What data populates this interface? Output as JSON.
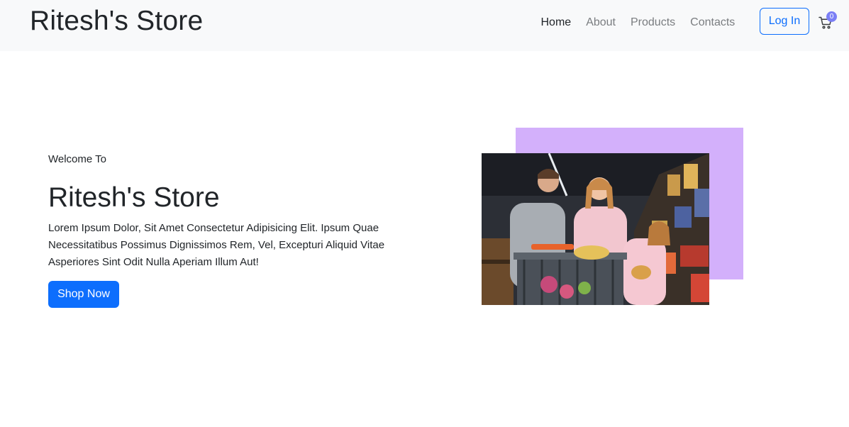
{
  "navbar": {
    "brand": "Ritesh's Store",
    "links": [
      {
        "label": "Home",
        "active": true
      },
      {
        "label": "About",
        "active": false
      },
      {
        "label": "Products",
        "active": false
      },
      {
        "label": "Contacts",
        "active": false
      }
    ],
    "login_label": "Log In",
    "cart_icon": "cart-icon",
    "cart_count": "0"
  },
  "hero": {
    "welcome": "Welcome To",
    "title": "Ritesh's Store",
    "description": "Lorem Ipsum Dolor, Sit Amet Consectetur Adipisicing Elit. Ipsum Quae Necessitatibus Possimus Dignissimos Rem, Vel, Excepturi Aliquid Vitae Asperiores Sint Odit Nulla Aperiam Illum Aut!",
    "button_label": "Shop Now",
    "image": "family-shopping-cart-photo"
  },
  "colors": {
    "primary": "#0d6efd",
    "accent_box": "#d3b0fb",
    "navbar_bg": "#f8f9fa",
    "badge": "#7b7ff5"
  }
}
